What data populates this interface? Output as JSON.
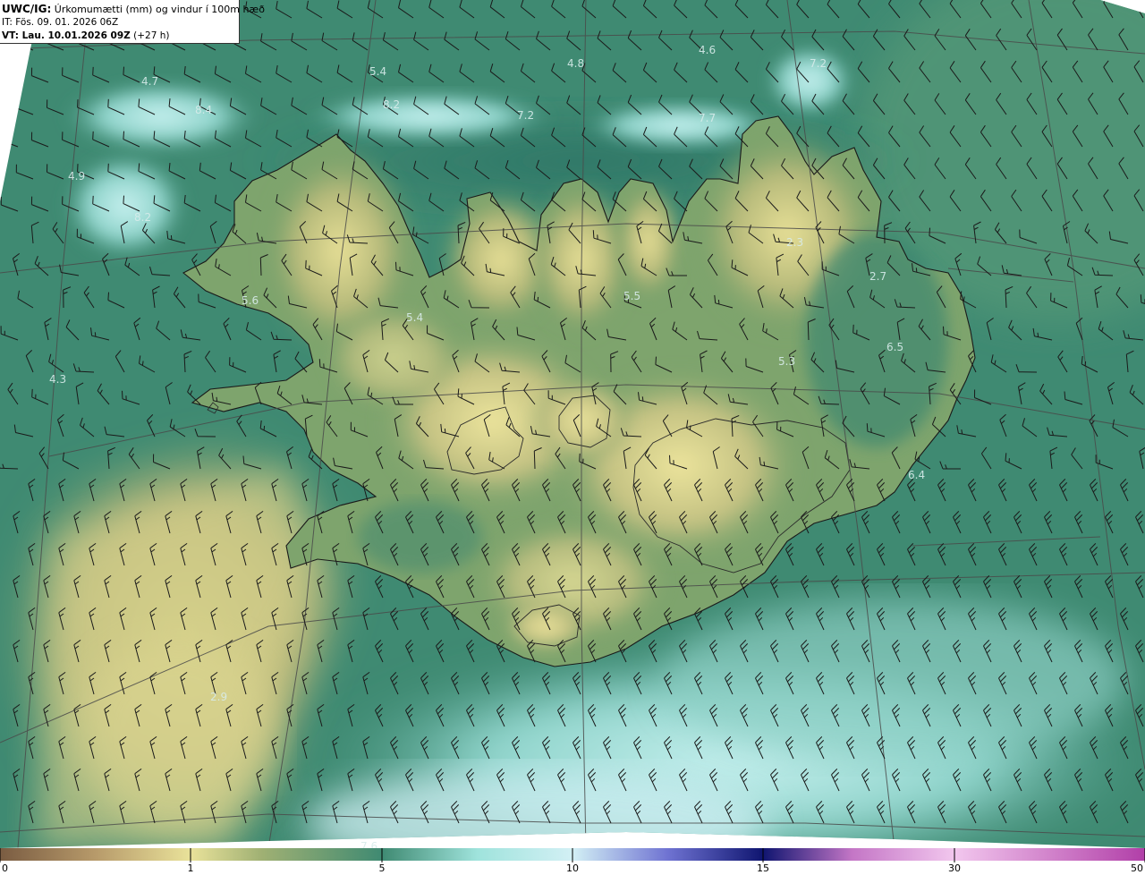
{
  "header": {
    "code": "UWC/IG:",
    "title": "Úrkomumætti (mm) og vindur í 100m hæð",
    "issue_time": "IT: Fös. 09. 01. 2026 06Z",
    "valid_prefix": "VT: Lau. 10.01.2026 09Z",
    "valid_offset": "(+27 h)"
  },
  "colorbar": {
    "ticks": [
      {
        "value": 0,
        "label": "0"
      },
      {
        "value": 1,
        "label": "1"
      },
      {
        "value": 5,
        "label": "5"
      },
      {
        "value": 10,
        "label": "10"
      },
      {
        "value": 15,
        "label": "15"
      },
      {
        "value": 30,
        "label": "30"
      },
      {
        "value": 50,
        "label": "50"
      }
    ],
    "stops": [
      {
        "value": 0,
        "color": "#7a5c42"
      },
      {
        "value": 0.5,
        "color": "#b79a6a"
      },
      {
        "value": 1,
        "color": "#e9e29a"
      },
      {
        "value": 2.5,
        "color": "#9fb073"
      },
      {
        "value": 5,
        "color": "#3f8a72"
      },
      {
        "value": 7.5,
        "color": "#9fe3dc"
      },
      {
        "value": 10,
        "color": "#d3f0f5"
      },
      {
        "value": 12.5,
        "color": "#6f73d2"
      },
      {
        "value": 15,
        "color": "#0f1570"
      },
      {
        "value": 22,
        "color": "#c476c6"
      },
      {
        "value": 30,
        "color": "#f2c7ee"
      },
      {
        "value": 50,
        "color": "#b13fa8"
      }
    ]
  },
  "value_labels": [
    "4.7",
    "8.4",
    "5.4",
    "8.2",
    "4.8",
    "7.2",
    "4.6",
    "7.2",
    "7.7",
    "4.9",
    "8.2",
    "5.6",
    "5.4",
    "5.5",
    "2.3",
    "2.7",
    "6.5",
    "5.3",
    "4.3",
    "6.4",
    "2.9",
    "7.6"
  ],
  "colors": {
    "ocean": "#3f8a72",
    "land_low": "#6b9a66",
    "land_high": "#e9e29a",
    "wet_sea": "#a9e3dc",
    "coast": "#1a1a1a",
    "barb": "#1a1a1a",
    "grid": "#4a4a4a"
  }
}
